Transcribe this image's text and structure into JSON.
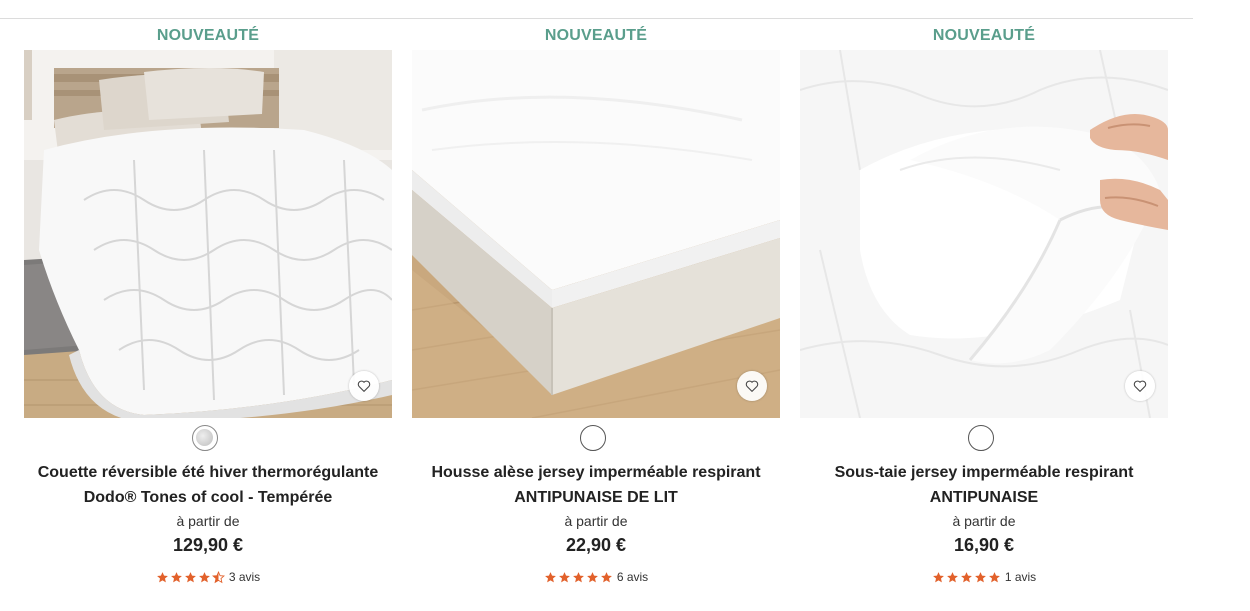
{
  "colors": {
    "badge": "#5a9e8c",
    "star": "#e2612b"
  },
  "products": [
    {
      "badge": "NOUVEAUTÉ",
      "title_line1": "Couette réversible été hiver thermorégulante",
      "title_line2": "Dodo® Tones of cool - Tempérée",
      "from_label": "à partir de",
      "price": "129,90 €",
      "rating": 4.5,
      "reviews": "3 avis",
      "image_icon": "duvet-photo",
      "swatch": "grey-swatch"
    },
    {
      "badge": "NOUVEAUTÉ",
      "title_line1": "Housse alèse jersey imperméable respirant",
      "title_line2": "ANTIPUNAISE DE LIT",
      "from_label": "à partir de",
      "price": "22,90 €",
      "rating": 5,
      "reviews": "6 avis",
      "image_icon": "mattress-protector-photo",
      "swatch": "white-swatch"
    },
    {
      "badge": "NOUVEAUTÉ",
      "title_line1": "Sous-taie jersey imperméable respirant",
      "title_line2": "ANTIPUNAISE",
      "from_label": "à partir de",
      "price": "16,90 €",
      "rating": 5,
      "reviews": "1 avis",
      "image_icon": "pillow-protector-photo",
      "swatch": "white-swatch"
    }
  ]
}
